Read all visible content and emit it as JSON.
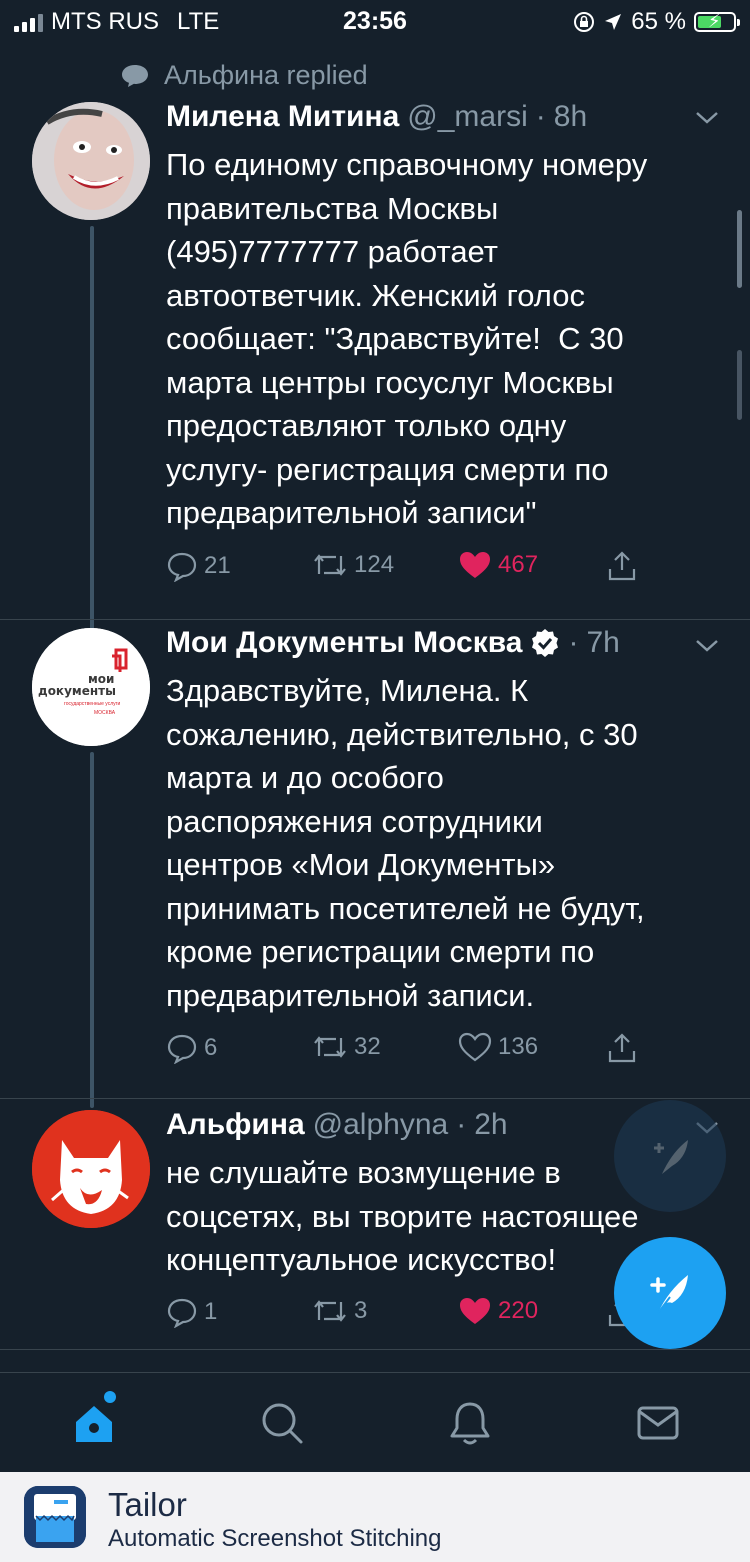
{
  "status_bar": {
    "carrier": "MTS RUS",
    "network": "LTE",
    "time": "23:56",
    "battery_percent": "65 %",
    "battery_level": 0.65,
    "icons": [
      "orientation-lock-icon",
      "location-arrow-icon",
      "battery-charging-icon"
    ]
  },
  "context": {
    "replied_text": "Альфина replied"
  },
  "tweets": [
    {
      "name": "Милена Митина",
      "handle": "@_marsi",
      "dot": "·",
      "time": "8h",
      "text": "По единому справочному номеру\nправительства Москвы\n(495)7777777 работает\nавтоответчик. Женский голос\nсообщает: \"Здравствуйте!  С 30\nмарта центры госуслуг Москвы\nпредоставляют только одну\nуслугу- регистрация смерти по\nпредварительной записи\"",
      "replies": "21",
      "retweets": "124",
      "likes": "467",
      "liked": true
    },
    {
      "name": "Мои Документы Москва",
      "verified": true,
      "dot": "·",
      "time": "7h",
      "text": "Здравствуйте, Милена. К\nсожалению, действительно, с 30\nмарта и до особого\nраспоряжения сотрудники\nцентров «Мои Документы»\nпринимать посетителей не будут,\nкроме регистрации смерти по\nпредварительной записи.",
      "replies": "6",
      "retweets": "32",
      "likes": "136",
      "liked": false,
      "avatar_logo": {
        "line1": "мои",
        "line2": "документы",
        "line3": "государственные услуги",
        "line4": "МОСКВА"
      }
    },
    {
      "name": "Альфина",
      "handle": "@alphyna",
      "dot": "·",
      "time": "2h",
      "text": "не слушайте возмущение в\nсоцсетях, вы творите настоящее\nконцептуальное искусство!",
      "replies": "1",
      "retweets": "3",
      "likes": "220",
      "liked": true
    }
  ],
  "tabs": [
    "home-icon",
    "search-icon",
    "notifications-icon",
    "messages-icon"
  ],
  "banner": {
    "title": "Tailor",
    "subtitle": "Automatic Screenshot Stitching"
  },
  "colors": {
    "background": "#15202b",
    "accent": "#1da1f2",
    "like": "#e0245e",
    "muted": "#8899a6"
  }
}
